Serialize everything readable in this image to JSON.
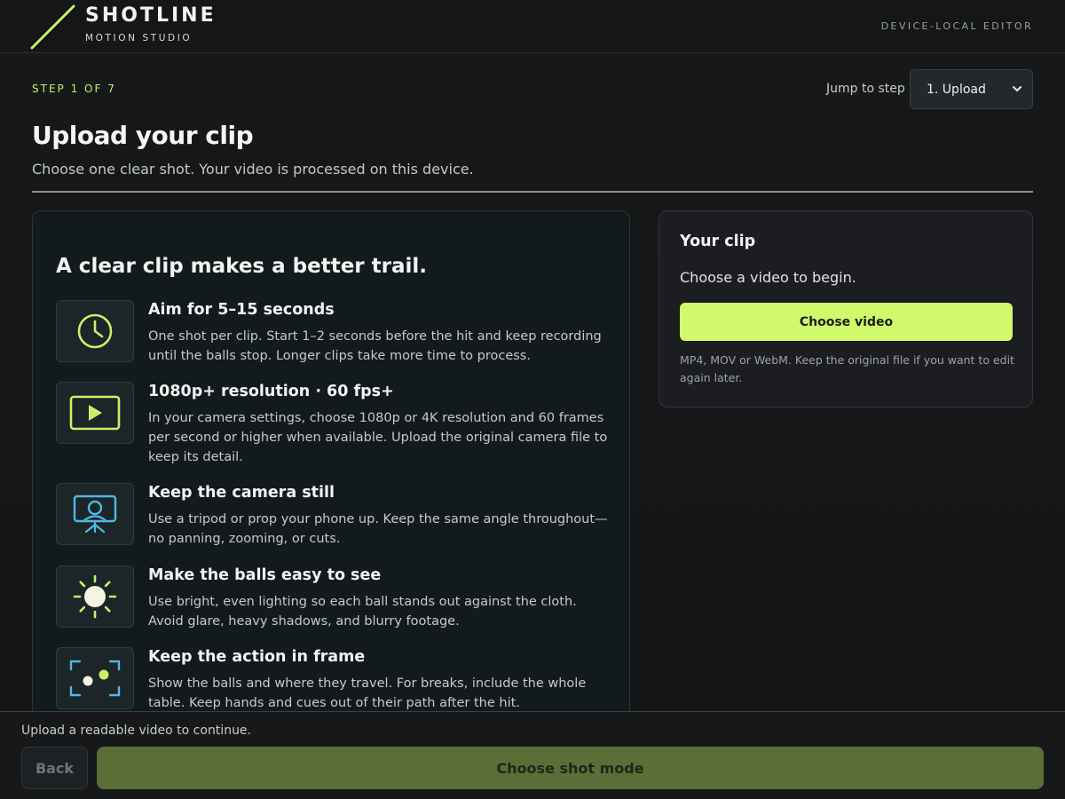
{
  "header": {
    "brand_name": "SHOTLINE",
    "brand_sub": "MOTION STUDIO",
    "right_label": "DEVICE-LOCAL EDITOR"
  },
  "stepper": {
    "step_label": "STEP 1 OF 7",
    "jump_label": "Jump to step",
    "selected": "1. Upload"
  },
  "page": {
    "title": "Upload your clip",
    "subtitle": "Choose one clear shot. Your video is processed on this device."
  },
  "tips": {
    "heading": "A clear clip makes a better trail.",
    "items": [
      {
        "icon": "clock-icon",
        "title": "Aim for 5–15 seconds",
        "body": "One shot per clip. Start 1–2 seconds before the hit and keep recording until the balls stop. Longer clips take more time to process."
      },
      {
        "icon": "play-icon",
        "title": "1080p+ resolution · 60 fps+",
        "body": "In your camera settings, choose 1080p or 4K resolution and 60 frames per second or higher when available. Upload the original camera file to keep its detail."
      },
      {
        "icon": "tripod-camera-icon",
        "title": "Keep the camera still",
        "body": "Use a tripod or prop your phone up. Keep the same angle throughout—no panning, zooming, or cuts."
      },
      {
        "icon": "sun-icon",
        "title": "Make the balls easy to see",
        "body": "Use bright, even lighting so each ball stands out against the cloth. Avoid glare, heavy shadows, and blurry footage."
      },
      {
        "icon": "frame-balls-icon",
        "title": "Keep the action in frame",
        "body": "Show the balls and where they travel. For breaks, include the whole table. Keep hands and cues out of their path after the hit."
      }
    ]
  },
  "clip": {
    "title": "Your clip",
    "prompt": "Choose a video to begin.",
    "button_label": "Choose video",
    "note": "MP4, MOV or WebM. Keep the original file if you want to edit again later."
  },
  "footer": {
    "status": "Upload a readable video to continue.",
    "back_label": "Back",
    "next_label": "Choose shot mode"
  },
  "colors": {
    "accent": "#d0fa6c",
    "accent_dim": "#5b6e38",
    "icon_blue": "#4fb8e6"
  }
}
